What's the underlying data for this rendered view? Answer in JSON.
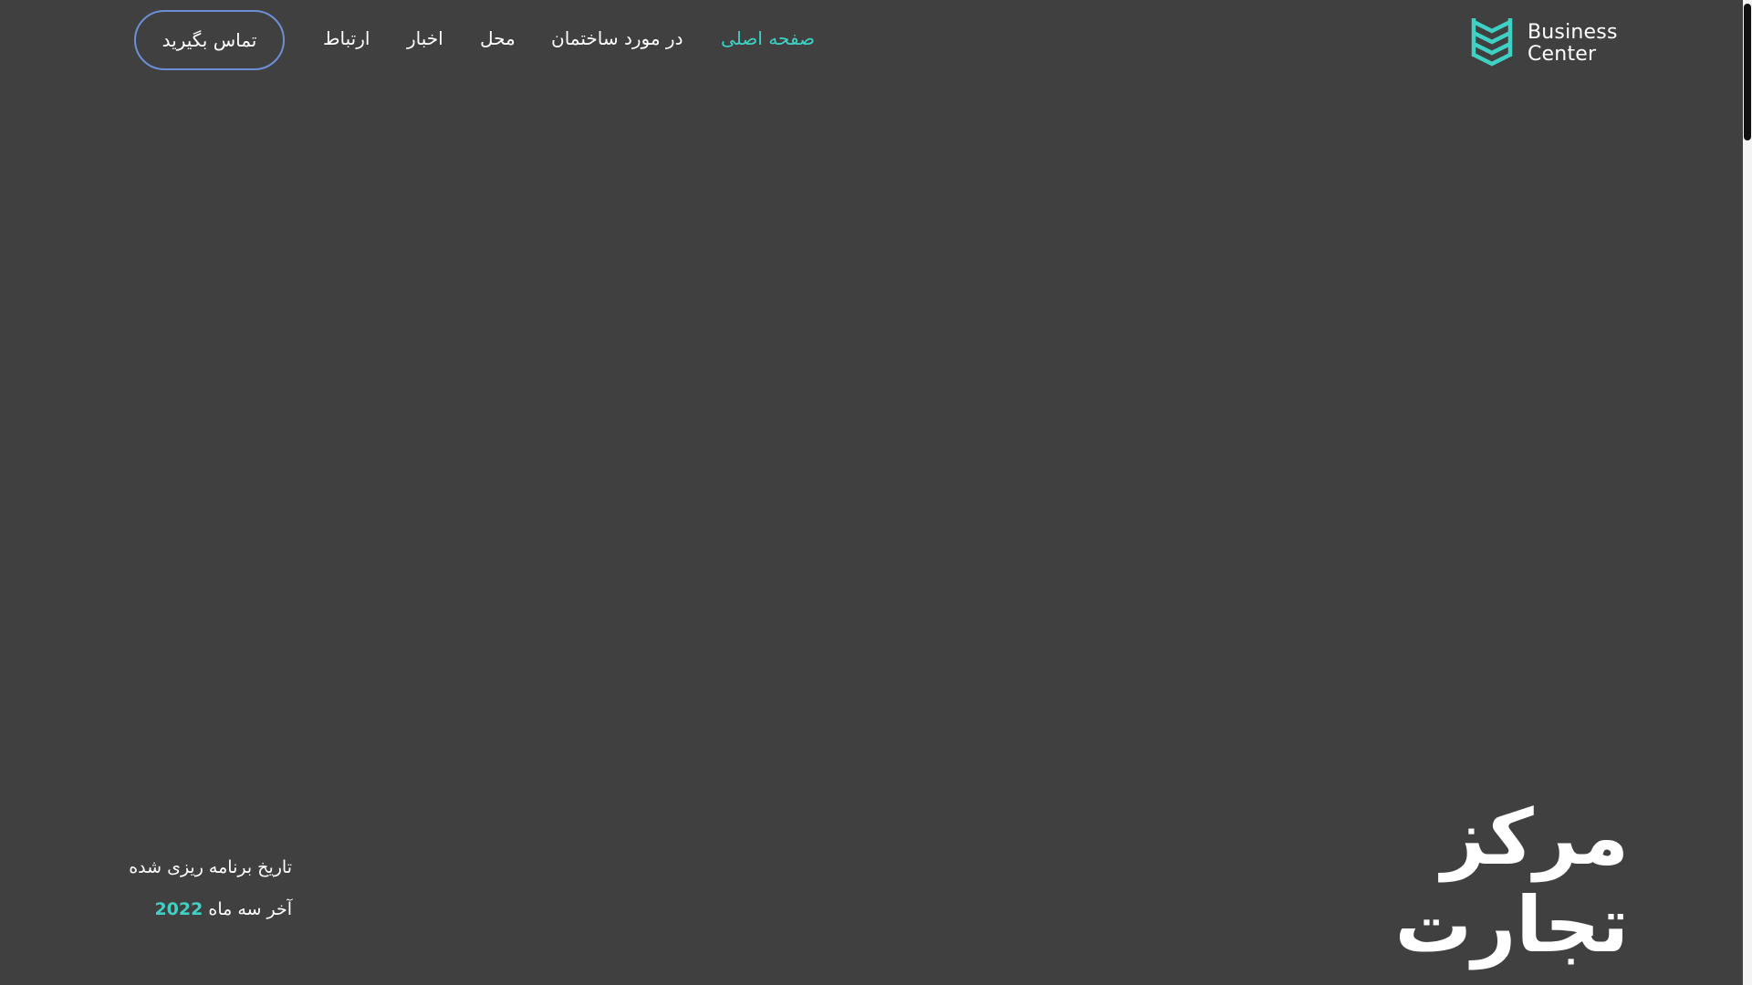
{
  "logo": {
    "line1": "Business",
    "line2": "Center",
    "icon": "stacked-chevrons-logo-icon",
    "color": "#3fd1c4"
  },
  "nav": {
    "home": "صفحه اصلی",
    "about": "در مورد ساختمان",
    "place": "محل",
    "news": "اخبار",
    "communication": "ارتباط",
    "contact_button": "تماس بگیرید"
  },
  "hero": {
    "title_line1": "مرکز",
    "title_line2": "تجارت"
  },
  "schedule": {
    "label": "تاریخ برنامه ریزی شده",
    "date_text": "آخر سه ماه",
    "year": "2022"
  },
  "colors": {
    "background": "#404040",
    "accent": "#3fd1c4",
    "button_border": "#6d8fd6",
    "text": "#ffffff"
  }
}
